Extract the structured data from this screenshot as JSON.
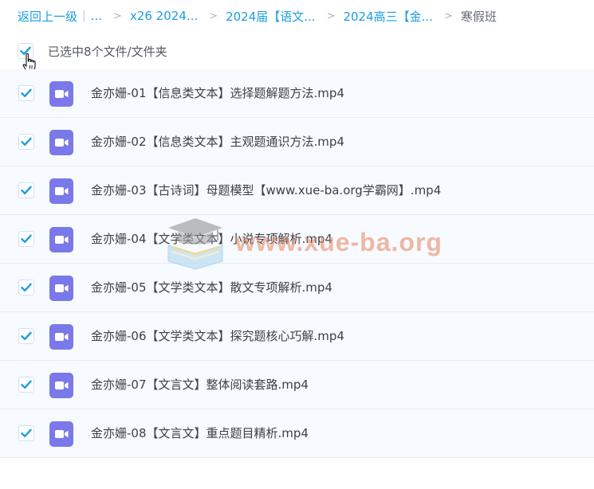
{
  "breadcrumb": {
    "back_label": "返回上一级",
    "separator": "|",
    "ellipsis": "...",
    "arrow": ">",
    "items": [
      "x26 2024...",
      "2024届【语文...",
      "2024高三【金..."
    ],
    "current": "寒假班"
  },
  "selection": {
    "label": "已选中8个文件/文件夹",
    "checked": true
  },
  "files": [
    {
      "name": "金亦姗-01【信息类文本】选择题解题方法.mp4",
      "checked": true,
      "icon": "video-file-icon"
    },
    {
      "name": "金亦姗-02【信息类文本】主观题通识方法.mp4",
      "checked": true,
      "icon": "video-file-icon"
    },
    {
      "name": "金亦姗-03【古诗词】母题模型【www.xue-ba.org学霸网】.mp4",
      "checked": true,
      "icon": "video-file-icon"
    },
    {
      "name": "金亦姗-04【文学类文本】小说专项解析.mp4",
      "checked": true,
      "icon": "video-file-icon"
    },
    {
      "name": "金亦姗-05【文学类文本】散文专项解析.mp4",
      "checked": true,
      "icon": "video-file-icon"
    },
    {
      "name": "金亦姗-06【文学类文本】探究题核心巧解.mp4",
      "checked": true,
      "icon": "video-file-icon"
    },
    {
      "name": "金亦姗-07【文言文】整体阅读套路.mp4",
      "checked": true,
      "icon": "video-file-icon"
    },
    {
      "name": "金亦姗-08【文言文】重点题目精析.mp4",
      "checked": true,
      "icon": "video-file-icon"
    }
  ],
  "watermark": {
    "text": "www.xue-ba.org",
    "icon": "graduation-cap-book-logo"
  },
  "colors": {
    "link": "#1a9ee0",
    "checkbox_check": "#1a9ee0",
    "file_icon": "#7b78ea",
    "row_background": "#f7fafe",
    "row_border": "#e3ecf6",
    "watermark": "#e5835e"
  }
}
